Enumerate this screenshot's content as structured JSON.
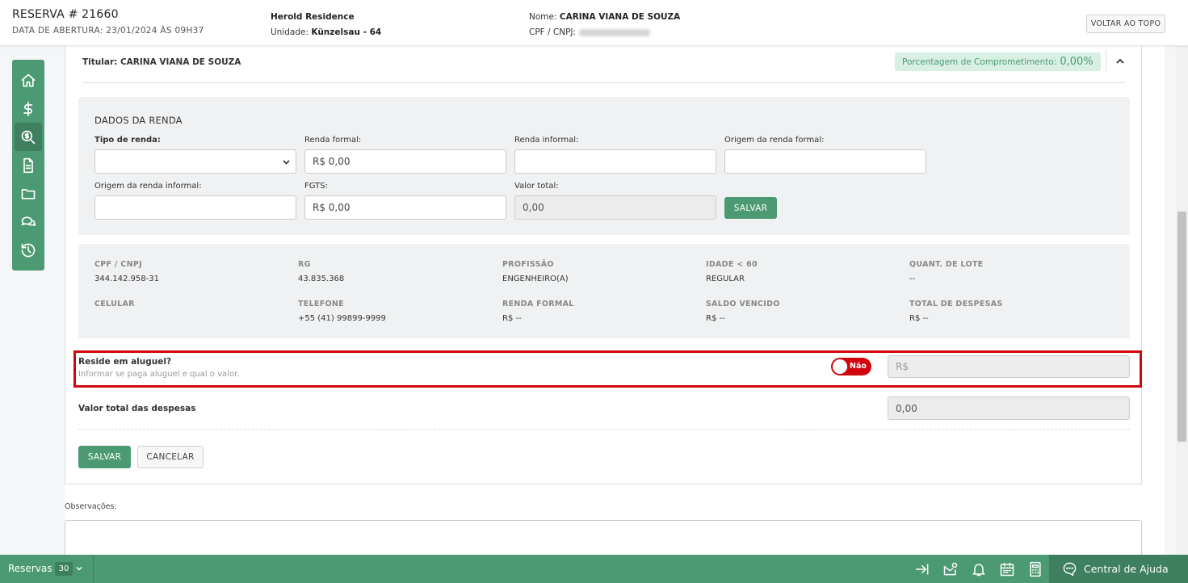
{
  "header": {
    "reserva_title": "RESERVA # 21660",
    "abertura": "DATA DE ABERTURA: 23/01/2024 ÀS 09H37",
    "empreendimento": "Herold Residence",
    "unidade_label": "Unidade:",
    "unidade_value": "Künzelsau - 64",
    "nome_label": "Nome:",
    "nome_value": "CARINA VIANA DE SOUZA",
    "cpf_label": "CPF / CNPJ:",
    "voltar_topo": "VOLTAR AO TOPO"
  },
  "sidebar": {
    "items": [
      {
        "icon": "home-icon"
      },
      {
        "icon": "dollar-icon"
      },
      {
        "icon": "search-dollar-icon",
        "active": true
      },
      {
        "icon": "document-icon"
      },
      {
        "icon": "folder-icon"
      },
      {
        "icon": "chat-icon"
      },
      {
        "icon": "history-icon"
      }
    ]
  },
  "card": {
    "titular": "Titular: CARINA VIANA DE SOUZA",
    "pct_label": "Porcentagem de Comprometimento:",
    "pct_value": "0,00%"
  },
  "renda": {
    "title": "DADOS DA RENDA",
    "tipo_label": "Tipo de renda:",
    "tipo_value": "",
    "formal_label": "Renda formal:",
    "formal_value": "R$ 0,00",
    "informal_label": "Renda informal:",
    "informal_value": "",
    "origem_formal_label": "Origem da renda formal:",
    "origem_formal_value": "",
    "origem_informal_label": "Origem da renda informal:",
    "origem_informal_value": "",
    "fgts_label": "FGTS:",
    "fgts_value": "R$ 0,00",
    "total_label": "Valor total:",
    "total_value": "0,00",
    "salvar": "SALVAR"
  },
  "info": {
    "row1": [
      {
        "label": "CPF / CNPJ",
        "value": "344.142.958-31"
      },
      {
        "label": "RG",
        "value": "43.835.368"
      },
      {
        "label": "PROFISSÃO",
        "value": "ENGENHEIRO(A)"
      },
      {
        "label": "IDADE < 60",
        "value": "REGULAR"
      },
      {
        "label": "QUANT. DE LOTE",
        "value": "--"
      }
    ],
    "row2": [
      {
        "label": "CELULAR",
        "value": ""
      },
      {
        "label": "TELEFONE",
        "value": "+55 (41) 99899-9999"
      },
      {
        "label": "RENDA FORMAL",
        "value": "R$ --"
      },
      {
        "label": "SALDO VENCIDO",
        "value": "R$ --"
      },
      {
        "label": "TOTAL DE DESPESAS",
        "value": "R$ --"
      }
    ]
  },
  "aluguel": {
    "question": "Reside em aluguel?",
    "hint": "Informar se paga aluguel e qual o valor.",
    "toggle_label": "Não",
    "placeholder": "R$"
  },
  "despesas": {
    "label": "Valor total das despesas",
    "value": "0,00"
  },
  "actions": {
    "salvar": "SALVAR",
    "cancelar": "CANCELAR"
  },
  "observacoes_label": "Observações:",
  "footer": {
    "reservas": "Reservas",
    "count": "30",
    "help": "Central de Ajuda"
  },
  "colors": {
    "primary": "#4b9a73",
    "primary_dark": "#3d7f5f",
    "highlight": "#d1040b"
  }
}
